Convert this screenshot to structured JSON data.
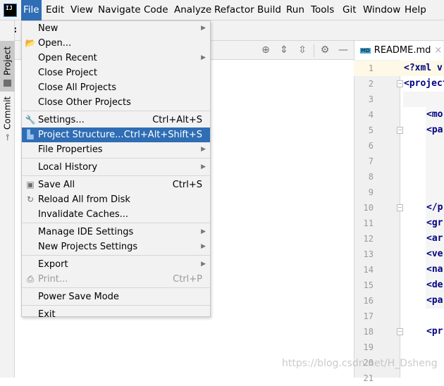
{
  "menubar": {
    "logo": "IJ",
    "items": [
      "File",
      "Edit",
      "View",
      "Navigate",
      "Code",
      "Analyze",
      "Refactor",
      "Build",
      "Run",
      "Tools",
      "Git",
      "Window",
      "Help"
    ],
    "active": "File"
  },
  "navbar": {
    "breadcrumb": "E:"
  },
  "stripe": {
    "project": "Project",
    "commit": "Commit"
  },
  "editor": {
    "tab": "README.md",
    "tab_icon": "MD",
    "line_numbers": [
      "1",
      "2",
      "3",
      "4",
      "5",
      "6",
      "7",
      "8",
      "9",
      "10",
      "11",
      "12",
      "13",
      "14",
      "15",
      "16",
      "17",
      "18",
      "19",
      "20",
      "21"
    ],
    "lines": [
      "<?xml v",
      "<project",
      "",
      "<mo",
      "<pa",
      "",
      "",
      "",
      "",
      "</p",
      "<gr",
      "<ar",
      "<ve",
      "<na",
      "<de",
      "<pa",
      "",
      "<pr",
      "",
      "",
      ""
    ]
  },
  "file_menu": {
    "items": [
      {
        "label": "New",
        "submenu": true
      },
      {
        "label": "Open...",
        "icon": "folder-open-icon"
      },
      {
        "label": "Open Recent",
        "submenu": true
      },
      {
        "label": "Close Project"
      },
      {
        "label": "Close All Projects"
      },
      {
        "label": "Close Other Projects"
      },
      {
        "sep": true
      },
      {
        "label": "Settings...",
        "shortcut": "Ctrl+Alt+S",
        "icon": "wrench-icon"
      },
      {
        "label": "Project Structure...",
        "shortcut": "Ctrl+Alt+Shift+S",
        "icon": "project-structure-icon",
        "highlighted": true
      },
      {
        "label": "File Properties",
        "submenu": true
      },
      {
        "sep": true
      },
      {
        "label": "Local History",
        "submenu": true
      },
      {
        "sep": true
      },
      {
        "label": "Save All",
        "shortcut": "Ctrl+S",
        "icon": "save-icon"
      },
      {
        "label": "Reload All from Disk",
        "icon": "reload-icon"
      },
      {
        "label": "Invalidate Caches..."
      },
      {
        "sep": true
      },
      {
        "label": "Manage IDE Settings",
        "submenu": true
      },
      {
        "label": "New Projects Settings",
        "submenu": true
      },
      {
        "sep": true
      },
      {
        "label": "Export",
        "submenu": true
      },
      {
        "label": "Print...",
        "shortcut": "Ctrl+P",
        "icon": "print-icon",
        "disabled": true
      },
      {
        "sep": true
      },
      {
        "label": "Power Save Mode"
      },
      {
        "sep": true
      },
      {
        "label": "Exit"
      }
    ]
  },
  "watermark": "https://blog.csdn.net/H_Dsheng",
  "colors": {
    "accent": "#2f6db5",
    "current_line": "#fdf9e6",
    "xml_tag": "#000080"
  }
}
